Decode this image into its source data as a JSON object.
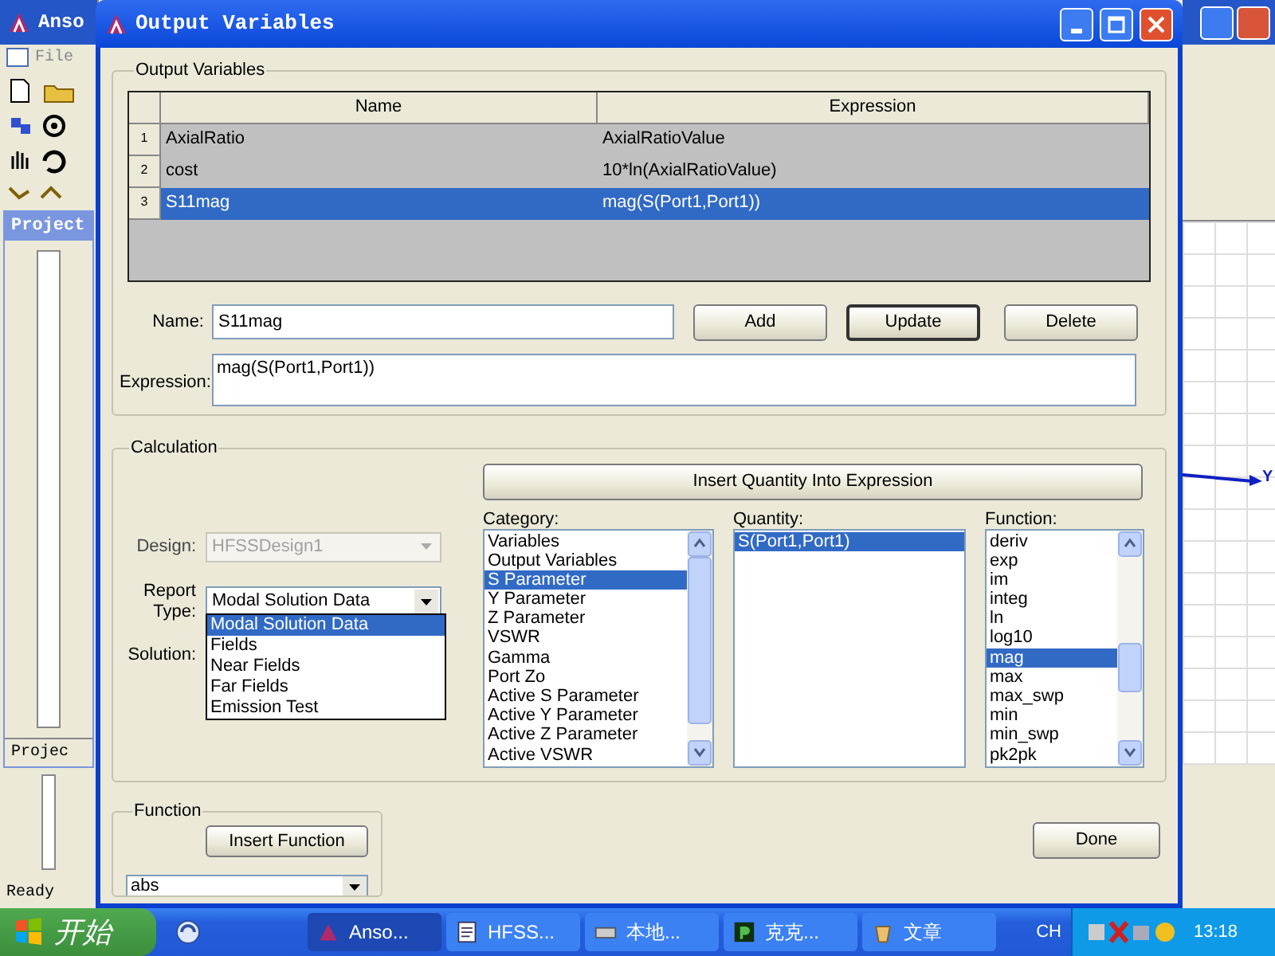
{
  "background_app": {
    "title": "Anso",
    "menu": [
      "File"
    ],
    "panel_title": "Project",
    "panel_tab": "Projec",
    "status": "Ready",
    "axis_label": "Y"
  },
  "dialog": {
    "title": "Output Variables",
    "output_variables": {
      "legend": "Output Variables",
      "columns": [
        "Name",
        "Expression"
      ],
      "rows": [
        {
          "number": "1",
          "name": "AxialRatio",
          "expression": "AxialRatioValue",
          "selected": false
        },
        {
          "number": "2",
          "name": "cost",
          "expression": "10*ln(AxialRatioValue)",
          "selected": false
        },
        {
          "number": "3",
          "name": "S11mag",
          "expression": "mag(S(Port1,Port1))",
          "selected": true
        }
      ]
    },
    "name_field": {
      "label": "Name:",
      "value": "S11mag"
    },
    "buttons": [
      {
        "label": "Add",
        "default": false
      },
      {
        "label": "Update",
        "default": true
      },
      {
        "label": "Delete",
        "default": false
      }
    ],
    "expression_field": {
      "label": "Expression:",
      "value": "mag(S(Port1,Port1))"
    },
    "calculation": {
      "legend": "Calculation",
      "design": {
        "label": "Design:",
        "value": "HFSSDesign1",
        "disabled": true
      },
      "report_type": {
        "label": "Report Type:",
        "value": "Modal Solution Data",
        "expanded": true,
        "options": [
          {
            "label": "Modal Solution Data",
            "selected": true
          },
          {
            "label": "Fields",
            "selected": false
          },
          {
            "label": "Near Fields",
            "selected": false
          },
          {
            "label": "Far Fields",
            "selected": false
          },
          {
            "label": "Emission Test",
            "selected": false
          }
        ]
      },
      "solution": {
        "label": "Solution:"
      },
      "insert_quantity_button": "Insert Quantity Into Expression",
      "category": {
        "label": "Category:",
        "items": [
          {
            "label": "Variables",
            "selected": false
          },
          {
            "label": "Output Variables",
            "selected": false
          },
          {
            "label": "S Parameter",
            "selected": true
          },
          {
            "label": "Y Parameter",
            "selected": false
          },
          {
            "label": "Z Parameter",
            "selected": false
          },
          {
            "label": "VSWR",
            "selected": false
          },
          {
            "label": "Gamma",
            "selected": false
          },
          {
            "label": "Port Zo",
            "selected": false
          },
          {
            "label": "Active S Parameter",
            "selected": false
          },
          {
            "label": "Active Y Parameter",
            "selected": false
          },
          {
            "label": "Active Z Parameter",
            "selected": false
          },
          {
            "label": "Active VSWR",
            "selected": false
          }
        ]
      },
      "quantity": {
        "label": "Quantity:",
        "items": [
          {
            "label": "S(Port1,Port1)",
            "selected": true
          }
        ]
      },
      "function": {
        "label": "Function:",
        "items": [
          {
            "label": "deriv",
            "selected": false
          },
          {
            "label": "exp",
            "selected": false
          },
          {
            "label": "im",
            "selected": false
          },
          {
            "label": "integ",
            "selected": false
          },
          {
            "label": "ln",
            "selected": false
          },
          {
            "label": "log10",
            "selected": false
          },
          {
            "label": "mag",
            "selected": true
          },
          {
            "label": "max",
            "selected": false
          },
          {
            "label": "max_swp",
            "selected": false
          },
          {
            "label": "min",
            "selected": false
          },
          {
            "label": "min_swp",
            "selected": false
          },
          {
            "label": "pk2pk",
            "selected": false
          }
        ]
      }
    },
    "function_group": {
      "legend": "Function",
      "insert_button": "Insert Function",
      "combo_value": "abs"
    },
    "done_button": "Done"
  },
  "taskbar": {
    "start": "开始",
    "tasks": [
      {
        "label": "Anso...",
        "selected": true
      },
      {
        "label": "HFSS...",
        "selected": false
      },
      {
        "label": "本地...",
        "selected": false
      },
      {
        "label": "克克...",
        "selected": false
      },
      {
        "label": "文章",
        "selected": false
      }
    ],
    "language": "CH",
    "clock": "13:18"
  }
}
